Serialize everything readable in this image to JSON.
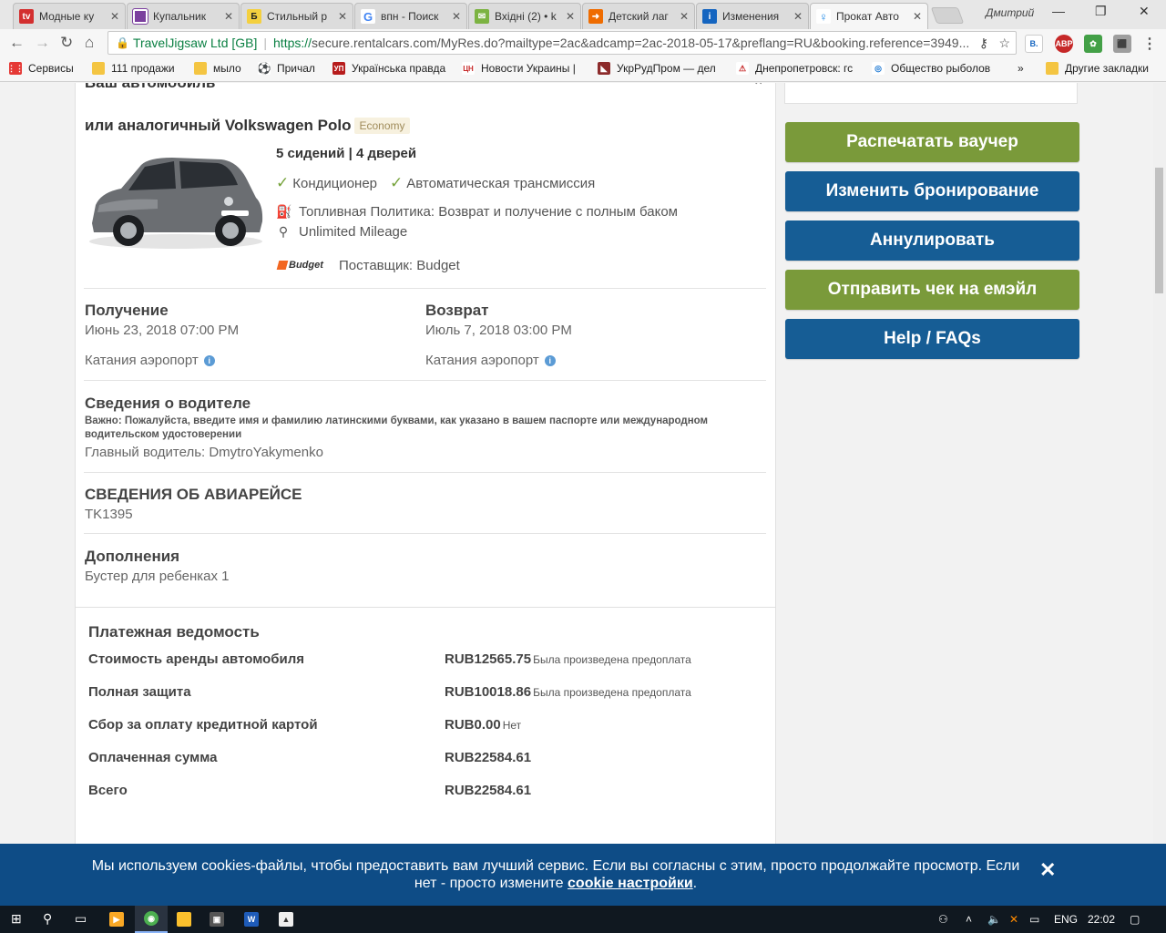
{
  "tabs": [
    {
      "label": "Модные ку",
      "icon": "tv-icon",
      "color": "#d32f2f",
      "glyph": "tv"
    },
    {
      "label": "Купальник ",
      "icon": "square-icon",
      "color": "#7b3f9e",
      "glyph": ""
    },
    {
      "label": "Стильный р",
      "icon": "b-icon",
      "color": "#f4d03f",
      "glyph": "Б"
    },
    {
      "label": "впн - Поиск",
      "icon": "google-icon",
      "color": "#4285f4",
      "glyph": "G"
    },
    {
      "label": "Вхідні (2) • k",
      "icon": "mail-icon",
      "color": "#7cb342",
      "glyph": "✉"
    },
    {
      "label": "Детский лаг",
      "icon": "arrow-icon",
      "color": "#ef6c00",
      "glyph": "➜"
    },
    {
      "label": "Изменения",
      "icon": "info-icon",
      "color": "#1565c0",
      "glyph": "i"
    },
    {
      "label": "Прокат Авто",
      "icon": "rentalcars-icon",
      "color": "#ffffff",
      "glyph": "♀"
    }
  ],
  "window": {
    "profile": "Дмитрий"
  },
  "omnibox": {
    "site": "TravelJigsaw Ltd [GB]",
    "scheme": "https://",
    "url": "secure.rentalcars.com/MyRes.do?mailtype=2ac&adcamp=2ac-2018-05-17&preflang=RU&booking.reference=3949..."
  },
  "bookmarks": {
    "items": [
      {
        "label": "Сервисы",
        "icon": "apps-icon",
        "color": "#d32f2f",
        "glyph": "⋮⋮"
      },
      {
        "label": "111 продажи",
        "icon": "folder-icon",
        "color": "#f4c542",
        "glyph": ""
      },
      {
        "label": "мыло",
        "icon": "folder-icon",
        "color": "#f4c542",
        "glyph": ""
      },
      {
        "label": "Причал",
        "icon": "ball-icon",
        "color": "#333333",
        "glyph": "⚽"
      },
      {
        "label": "Українська правда",
        "icon": "up-icon",
        "color": "#b71c1c",
        "glyph": "УП"
      },
      {
        "label": "Новости Украины |",
        "icon": "cn-icon",
        "color": "#c62828",
        "glyph": "ЦН"
      },
      {
        "label": "УкрРудПром — дел",
        "icon": "ukrrud-icon",
        "color": "#8d2c2c",
        "glyph": "◣"
      },
      {
        "label": "Днепропетровск: гс",
        "icon": "dnipro-icon",
        "color": "#c62828",
        "glyph": "⚠"
      },
      {
        "label": "Общество рыболов",
        "icon": "fish-icon",
        "color": "#1976d2",
        "glyph": "◎"
      }
    ],
    "more": "»",
    "other": "Другие закладки"
  },
  "booking": {
    "section_title_partial": "Ваш автомобиль",
    "car_title": "или аналогичный Volkswagen Polo",
    "car_class": "Economy",
    "seats_doors": "5 сидений | 4 дверей",
    "feature_ac": "Кондиционер",
    "feature_trans": "Автоматическая трансмиссия",
    "fuel_policy": "Топливная Политика: Возврат и получение с полным баком",
    "mileage": "Unlimited Mileage",
    "supplier_logo": "Budget",
    "supplier": "Поставщик: Budget",
    "pickup": {
      "heading": "Получение",
      "datetime": "Июнь 23, 2018 07:00 PM",
      "location": "Катания аэропорт"
    },
    "dropoff": {
      "heading": "Возврат",
      "datetime": "Июль 7, 2018 03:00 PM",
      "location": "Катания аэропорт"
    },
    "driver": {
      "heading": "Сведения о водителе",
      "note": "Важно: Пожалуйста, введите имя и фамилию латинскими буквами, как указано в вашем паспорте или международном водительском удостоверении",
      "main_driver": "Главный водитель: DmytroYakymenko"
    },
    "flight": {
      "heading": "СВЕДЕНИЯ ОБ АВИАРЕЙСЕ",
      "number": "TK1395"
    },
    "extras": {
      "heading": "Дополнения",
      "item": "Бустер для ребенка",
      "qty": "x 1"
    }
  },
  "payment": {
    "heading": "Платежная ведомость",
    "rows": [
      {
        "label": "Стоимость аренды автомобиля",
        "amount": "RUB12565.75",
        "note": "Была произведена предоплата"
      },
      {
        "label": "Полная защита",
        "amount": "RUB10018.86",
        "note": "Была произведена предоплата"
      },
      {
        "label": "Сбор за оплату кредитной картой",
        "amount": "RUB0.00",
        "note": "Нет"
      },
      {
        "label": "Оплаченная сумма",
        "amount": "RUB22584.61",
        "note": ""
      },
      {
        "label": "Всего",
        "amount": "RUB22584.61",
        "note": ""
      }
    ]
  },
  "actions": [
    {
      "label": "Распечатать ваучер",
      "color": "#7a9a3a"
    },
    {
      "label": "Изменить бронирование",
      "color": "#165d95"
    },
    {
      "label": "Аннулировать",
      "color": "#165d95"
    },
    {
      "label": "Отправить чек на емэйл",
      "color": "#7a9a3a"
    },
    {
      "label": "Help / FAQs",
      "color": "#165d95"
    }
  ],
  "cookie": {
    "text_before": "Мы используем cookies-файлы, чтобы предоставить вам лучший сервис. Если вы согласны с этим, просто продолжайте просмотр. Если нет - просто измените ",
    "link": "cookie настройки",
    "text_after": "."
  },
  "taskbar": {
    "language": "ENG",
    "time": "22:02"
  }
}
